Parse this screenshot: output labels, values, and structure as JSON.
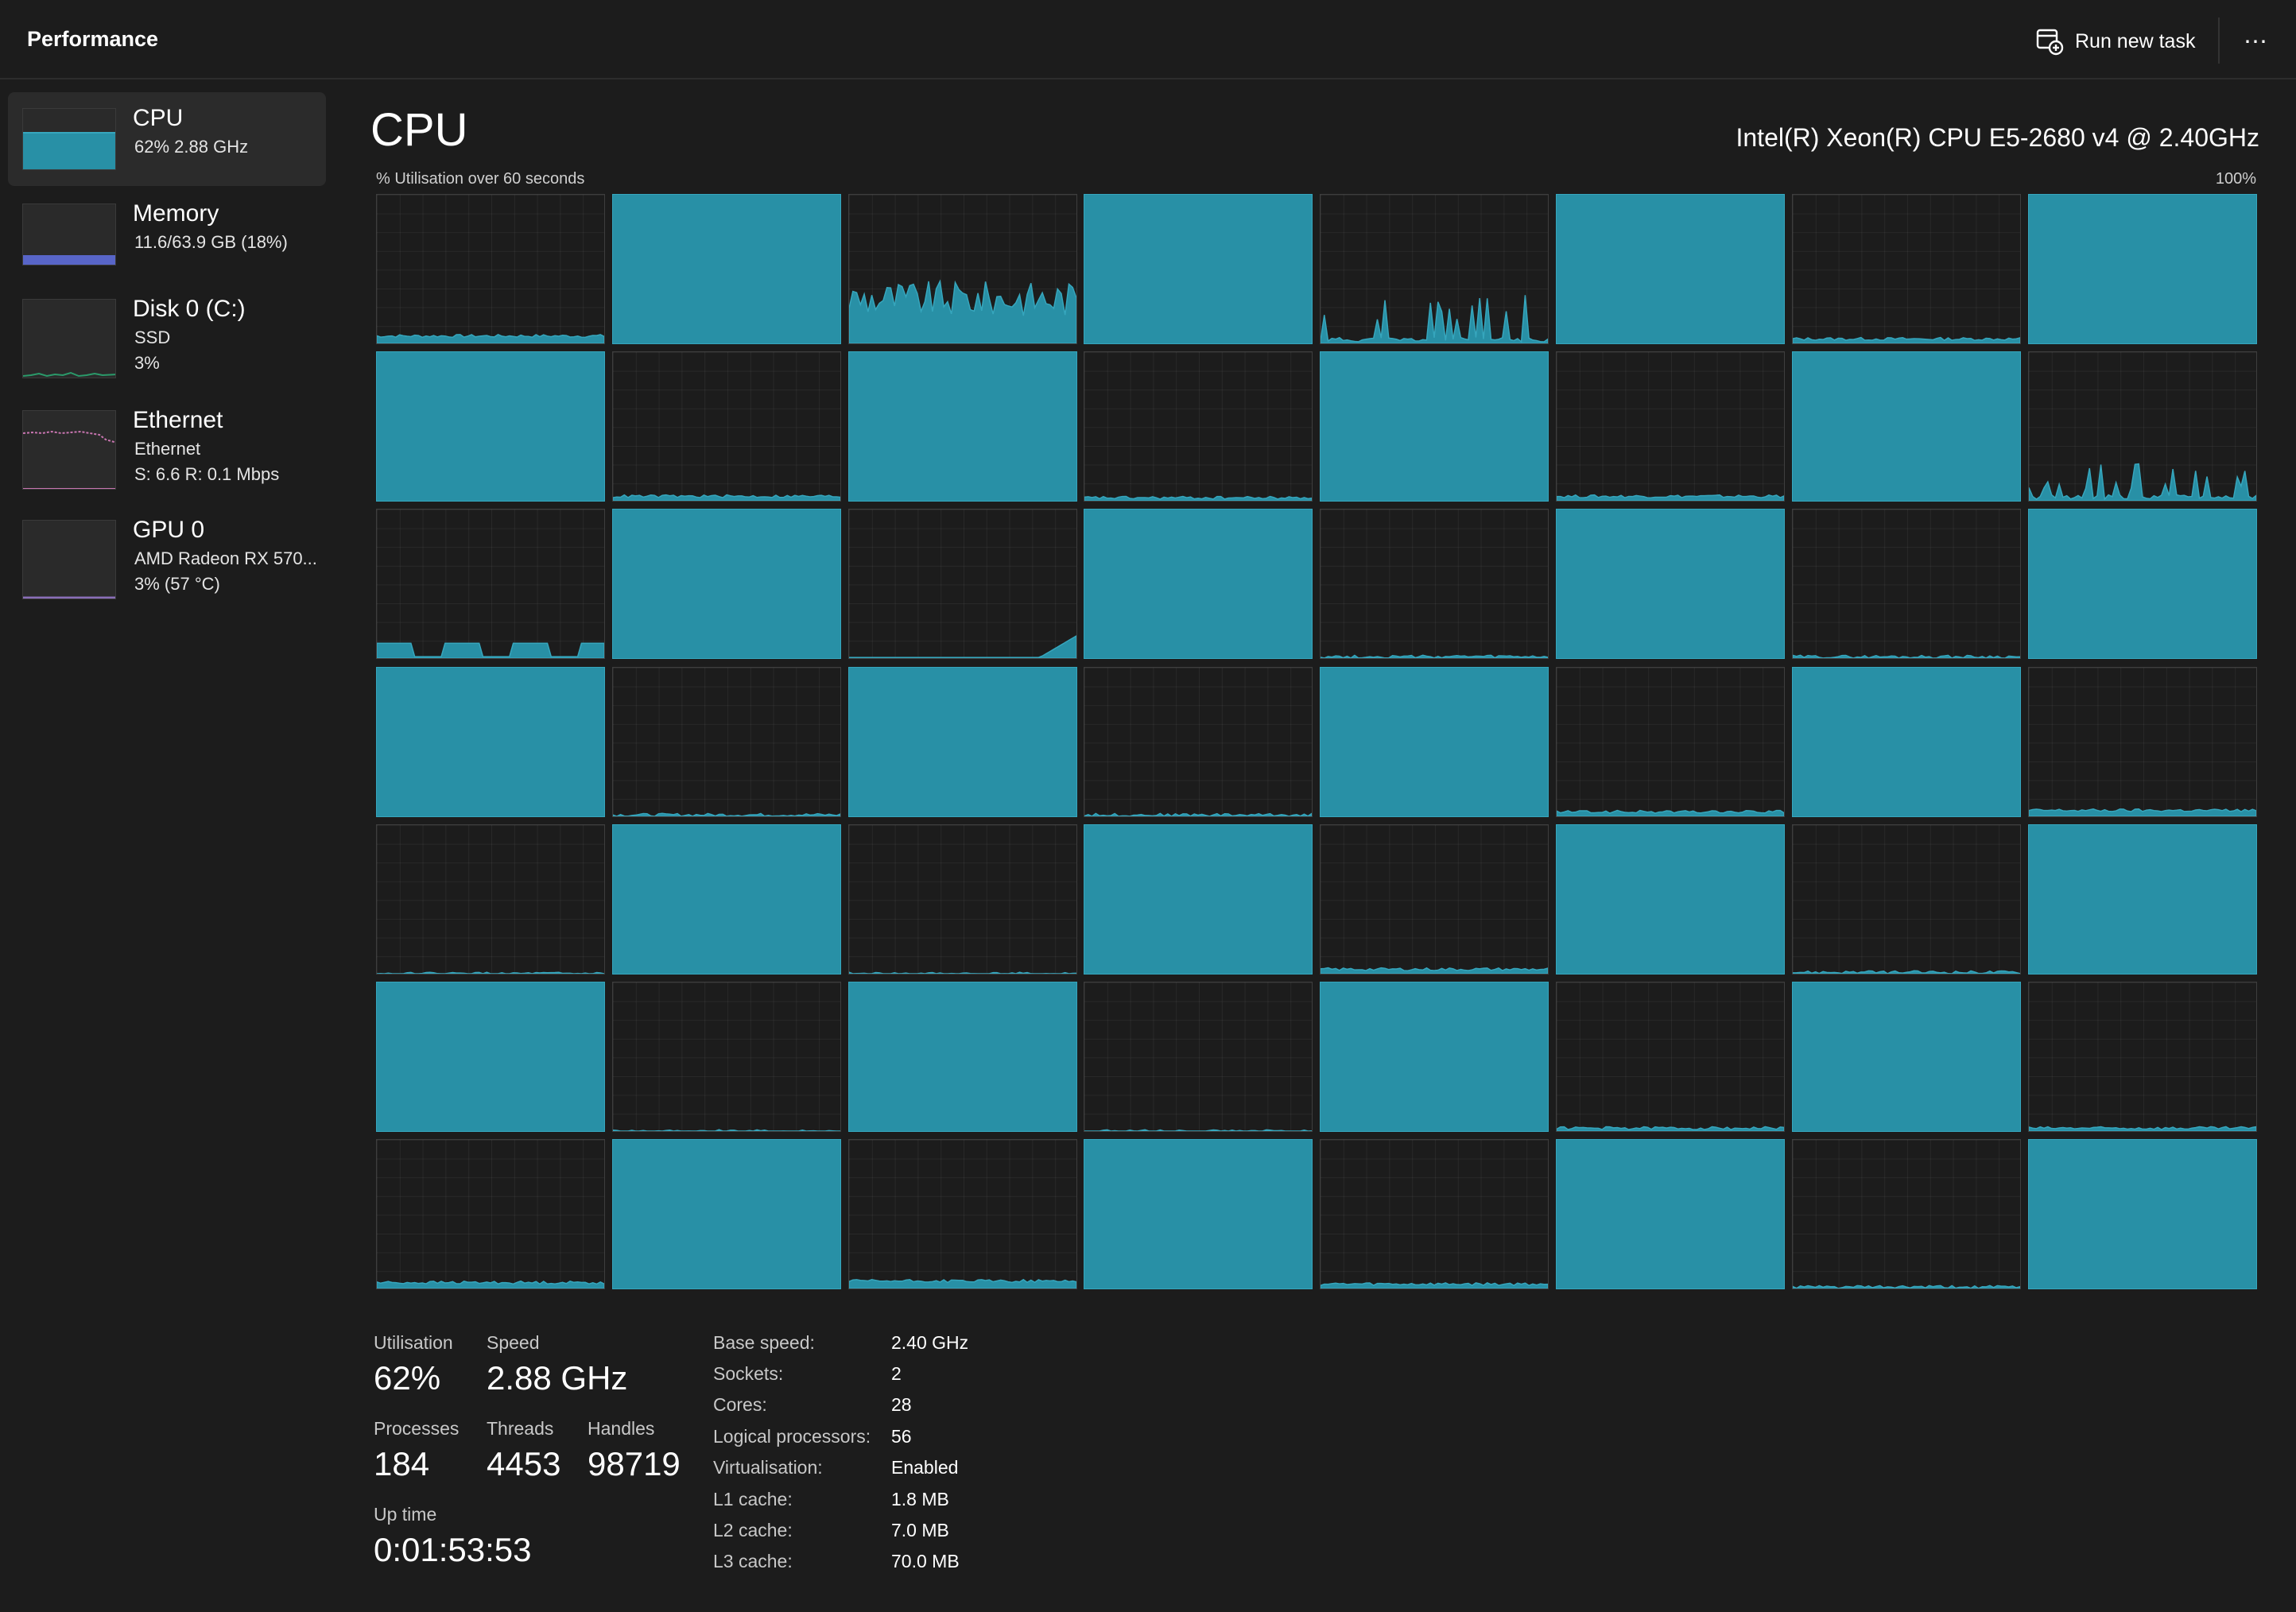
{
  "app": {
    "title": "Performance"
  },
  "toolbar": {
    "run_new_task": "Run new task",
    "more": "⋯"
  },
  "sidebar": {
    "items": [
      {
        "title": "CPU",
        "sub1": "62%  2.88 GHz",
        "sub2": "",
        "selected": true
      },
      {
        "title": "Memory",
        "sub1": "11.6/63.9 GB (18%)",
        "sub2": ""
      },
      {
        "title": "Disk 0 (C:)",
        "sub1": "SSD",
        "sub2": "3%"
      },
      {
        "title": "Ethernet",
        "sub1": "Ethernet",
        "sub2": "S: 6.6  R: 0.1 Mbps"
      },
      {
        "title": "GPU 0",
        "sub1": "AMD Radeon RX 570...",
        "sub2": "3%  (57 °C)"
      }
    ]
  },
  "main": {
    "title": "CPU",
    "cpu_model": "Intel(R) Xeon(R) CPU E5-2680 v4 @ 2.40GHz",
    "graph_label": "% Utilisation over 60 seconds",
    "graph_max": "100%"
  },
  "colors": {
    "accent": "#2890a6",
    "accent_line": "#36a6bd",
    "memory": "#5865c8",
    "ethernet": "#c875b0",
    "gpu": "#8a6fb8"
  },
  "chart_data": {
    "type": "area",
    "logical_processors": 56,
    "grid_rows": 7,
    "grid_cols": 8,
    "y_range": [
      0,
      100
    ],
    "cores": [
      {
        "level": 5,
        "pattern": "low"
      },
      {
        "level": 100,
        "pattern": "full"
      },
      {
        "level": 30,
        "pattern": "noisy"
      },
      {
        "level": 100,
        "pattern": "full"
      },
      {
        "level": 15,
        "pattern": "spikes"
      },
      {
        "level": 100,
        "pattern": "full"
      },
      {
        "level": 3,
        "pattern": "low"
      },
      {
        "level": 100,
        "pattern": "full"
      },
      {
        "level": 100,
        "pattern": "full"
      },
      {
        "level": 3,
        "pattern": "low"
      },
      {
        "level": 100,
        "pattern": "full"
      },
      {
        "level": 2,
        "pattern": "low"
      },
      {
        "level": 100,
        "pattern": "full"
      },
      {
        "level": 3,
        "pattern": "low"
      },
      {
        "level": 100,
        "pattern": "full"
      },
      {
        "level": 8,
        "pattern": "spikes"
      },
      {
        "level": 10,
        "pattern": "blocks"
      },
      {
        "level": 100,
        "pattern": "full"
      },
      {
        "level": 3,
        "pattern": "ramp"
      },
      {
        "level": 100,
        "pattern": "full"
      },
      {
        "level": 1,
        "pattern": "low"
      },
      {
        "level": 100,
        "pattern": "full"
      },
      {
        "level": 1,
        "pattern": "low"
      },
      {
        "level": 100,
        "pattern": "full"
      },
      {
        "level": 100,
        "pattern": "full"
      },
      {
        "level": 1,
        "pattern": "low"
      },
      {
        "level": 100,
        "pattern": "full"
      },
      {
        "level": 1,
        "pattern": "low"
      },
      {
        "level": 100,
        "pattern": "full"
      },
      {
        "level": 3,
        "pattern": "low"
      },
      {
        "level": 100,
        "pattern": "full"
      },
      {
        "level": 4,
        "pattern": "low"
      },
      {
        "level": 0,
        "pattern": "low"
      },
      {
        "level": 100,
        "pattern": "full"
      },
      {
        "level": 0,
        "pattern": "low"
      },
      {
        "level": 100,
        "pattern": "full"
      },
      {
        "level": 3,
        "pattern": "low"
      },
      {
        "level": 100,
        "pattern": "full"
      },
      {
        "level": 1,
        "pattern": "low"
      },
      {
        "level": 100,
        "pattern": "full"
      },
      {
        "level": 100,
        "pattern": "full"
      },
      {
        "level": 0,
        "pattern": "low"
      },
      {
        "level": 100,
        "pattern": "full"
      },
      {
        "level": 0,
        "pattern": "low"
      },
      {
        "level": 100,
        "pattern": "full"
      },
      {
        "level": 2,
        "pattern": "low"
      },
      {
        "level": 100,
        "pattern": "full"
      },
      {
        "level": 2,
        "pattern": "low"
      },
      {
        "level": 4,
        "pattern": "low"
      },
      {
        "level": 100,
        "pattern": "full"
      },
      {
        "level": 5,
        "pattern": "low"
      },
      {
        "level": 100,
        "pattern": "full"
      },
      {
        "level": 3,
        "pattern": "low"
      },
      {
        "level": 100,
        "pattern": "full"
      },
      {
        "level": 1,
        "pattern": "low"
      },
      {
        "level": 100,
        "pattern": "full"
      }
    ]
  },
  "stats": {
    "utilisation_label": "Utilisation",
    "utilisation": "62%",
    "speed_label": "Speed",
    "speed": "2.88 GHz",
    "processes_label": "Processes",
    "processes": "184",
    "threads_label": "Threads",
    "threads": "4453",
    "handles_label": "Handles",
    "handles": "98719",
    "uptime_label": "Up time",
    "uptime": "0:01:53:53"
  },
  "specs": [
    {
      "key": "Base speed:",
      "value": "2.40 GHz"
    },
    {
      "key": "Sockets:",
      "value": "2"
    },
    {
      "key": "Cores:",
      "value": "28"
    },
    {
      "key": "Logical processors:",
      "value": "56"
    },
    {
      "key": "Virtualisation:",
      "value": "Enabled"
    },
    {
      "key": "L1 cache:",
      "value": "1.8 MB"
    },
    {
      "key": "L2 cache:",
      "value": "7.0 MB"
    },
    {
      "key": "L3 cache:",
      "value": "70.0 MB"
    }
  ]
}
